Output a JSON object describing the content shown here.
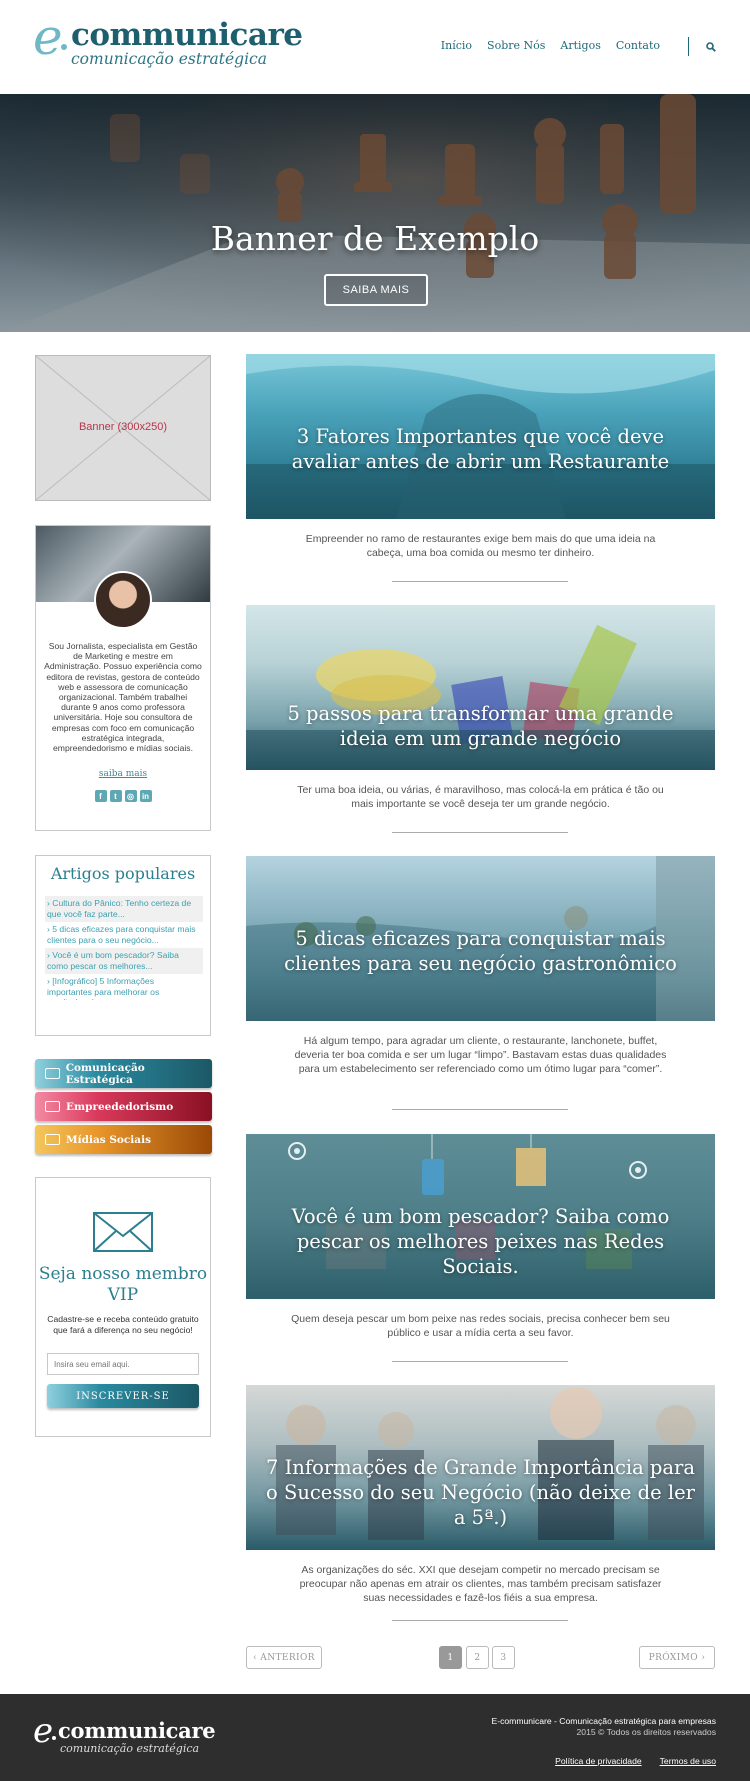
{
  "brand": {
    "logo_e": "e",
    "logo_word": "communicare",
    "logo_tagline": "comunicação estratégica"
  },
  "nav": {
    "items": [
      "Início",
      "Sobre Nós",
      "Artigos",
      "Contato"
    ]
  },
  "hero": {
    "title": "Banner de Exemplo",
    "button": "SAIBA MAIS"
  },
  "sidebar": {
    "ad_label": "Banner (300x250)",
    "bio": {
      "text": "Sou Jornalista, especialista em Gestão de Marketing e mestre em Administração. Possuo experiência como editora de revistas, gestora de conteúdo web e assessora de comunicação organizacional. Também trabalhei durante 9 anos como professora universitária. Hoje sou consultora de empresas com foco em comunicação estratégica integrada, empreendedorismo e mídias sociais.",
      "more_link": "saiba mais",
      "socials": [
        "f",
        "t",
        "ig",
        "in"
      ]
    },
    "popular": {
      "title": "Artigos populares",
      "items": [
        "› Cultura do Pânico: Tenho certeza de que você faz parte...",
        "› 5 dicas eficazes para conquistar mais clientes para o seu negócio...",
        "› Você é um bom pescador? Saiba como pescar os melhores...",
        "› [Infográfico] 5 Informações importantes para melhorar os resultados de sua..."
      ]
    },
    "categories": [
      {
        "label": "Comunicação Estratégica",
        "color": "#1c5866"
      },
      {
        "label": "Empreededorismo",
        "color": "#8a1023"
      },
      {
        "label": "Mídias Sociais",
        "color": "#9a4a06"
      }
    ],
    "vip": {
      "title": "Seja nosso membro VIP",
      "text": "Cadastre-se e receba conteúdo gratuito que fará a diferença no seu negócio!",
      "placeholder": "Insira seu email aqui.",
      "button": "INSCREVER-SE"
    }
  },
  "articles": [
    {
      "title": "3 Fatores Importantes que você deve avaliar antes de abrir um Restaurante",
      "excerpt": "Empreender no ramo de restaurantes exige bem mais do que uma ideia na cabeça, uma boa comida ou mesmo ter dinheiro."
    },
    {
      "title": "5 passos para transformar uma grande ideia em um grande negócio",
      "excerpt": "Ter uma boa ideia, ou várias, é maravilhoso, mas colocá-la em prática é tão ou mais importante se você deseja ter um grande negócio."
    },
    {
      "title": "5 dicas eficazes para conquistar mais clientes para seu negócio gastronômico",
      "excerpt": "Há algum tempo, para agradar um cliente, o restaurante, lanchonete, buffet, deveria ter boa comida e ser um lugar “limpo”. Bastavam estas duas qualidades para um estabelecimento ser referenciado como um ótimo lugar para “comer”."
    },
    {
      "title": "Você é um bom pescador? Saiba como pescar os melhores peixes nas Redes Sociais.",
      "excerpt": "Quem deseja pescar um bom peixe nas redes sociais, precisa conhecer bem seu público e usar a mídia certa a seu favor."
    },
    {
      "title": "7 Informações de Grande Importância para o Sucesso do seu Negócio (não deixe de ler a 5ª.)",
      "excerpt": "As organizações do séc. XXI que desejam competir no mercado precisam se preocupar não apenas em atrair os clientes, mas também precisam satisfazer suas necessidades e fazê-los fiéis a sua empresa."
    }
  ],
  "pagination": {
    "prev": "‹ ANTERIOR",
    "pages": [
      "1",
      "2",
      "3"
    ],
    "active": "1",
    "next": "PRÓXIMO ›"
  },
  "footer": {
    "line1": "E-communicare - Comunicação estratégica para empresas",
    "line2": "2015 © Todos os direitos reservados",
    "links": [
      "Política de privacidade",
      "Termos de uso"
    ]
  }
}
